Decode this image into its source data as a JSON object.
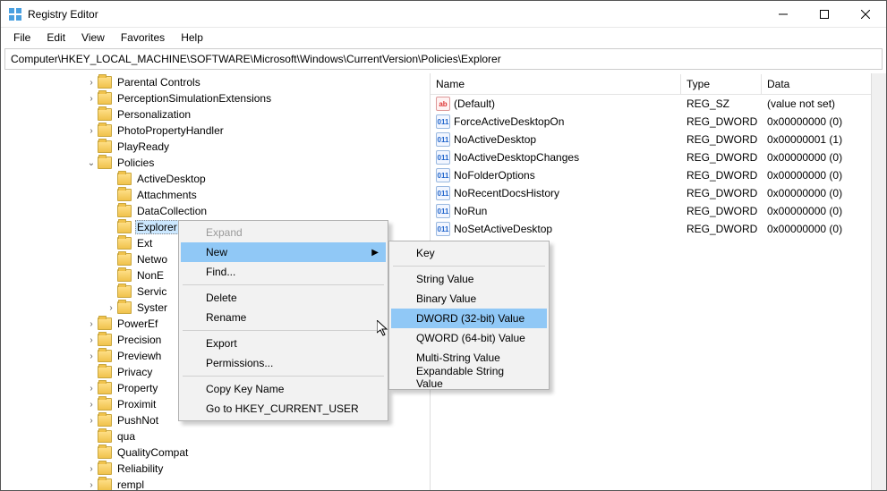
{
  "window": {
    "title": "Registry Editor"
  },
  "menu": [
    "File",
    "Edit",
    "View",
    "Favorites",
    "Help"
  ],
  "address": "Computer\\HKEY_LOCAL_MACHINE\\SOFTWARE\\Microsoft\\Windows\\CurrentVersion\\Policies\\Explorer",
  "tree": [
    {
      "indent": 3,
      "caret": ">",
      "label": "Parental Controls"
    },
    {
      "indent": 3,
      "caret": ">",
      "label": "PerceptionSimulationExtensions"
    },
    {
      "indent": 3,
      "caret": "",
      "label": "Personalization"
    },
    {
      "indent": 3,
      "caret": ">",
      "label": "PhotoPropertyHandler"
    },
    {
      "indent": 3,
      "caret": "",
      "label": "PlayReady"
    },
    {
      "indent": 3,
      "caret": "v",
      "label": "Policies"
    },
    {
      "indent": 4,
      "caret": "",
      "label": "ActiveDesktop"
    },
    {
      "indent": 4,
      "caret": "",
      "label": "Attachments"
    },
    {
      "indent": 4,
      "caret": "",
      "label": "DataCollection"
    },
    {
      "indent": 4,
      "caret": "",
      "label": "Explorer",
      "selected": true
    },
    {
      "indent": 4,
      "caret": "",
      "label": "Ext"
    },
    {
      "indent": 4,
      "caret": "",
      "label": "Netwo"
    },
    {
      "indent": 4,
      "caret": "",
      "label": "NonE"
    },
    {
      "indent": 4,
      "caret": "",
      "label": "Servic"
    },
    {
      "indent": 4,
      "caret": ">",
      "label": "Syster"
    },
    {
      "indent": 3,
      "caret": ">",
      "label": "PowerEf"
    },
    {
      "indent": 3,
      "caret": ">",
      "label": "Precision"
    },
    {
      "indent": 3,
      "caret": ">",
      "label": "Previewh"
    },
    {
      "indent": 3,
      "caret": "",
      "label": "Privacy"
    },
    {
      "indent": 3,
      "caret": ">",
      "label": "Property"
    },
    {
      "indent": 3,
      "caret": ">",
      "label": "Proximit"
    },
    {
      "indent": 3,
      "caret": ">",
      "label": "PushNot"
    },
    {
      "indent": 3,
      "caret": "",
      "label": "qua"
    },
    {
      "indent": 3,
      "caret": "",
      "label": "QualityCompat"
    },
    {
      "indent": 3,
      "caret": ">",
      "label": "Reliability"
    },
    {
      "indent": 3,
      "caret": ">",
      "label": "rempl"
    }
  ],
  "columns": {
    "name": "Name",
    "type": "Type",
    "data": "Data"
  },
  "values": [
    {
      "icon": "sz",
      "name": "(Default)",
      "type": "REG_SZ",
      "data": "(value not set)"
    },
    {
      "icon": "dw",
      "name": "ForceActiveDesktopOn",
      "type": "REG_DWORD",
      "data": "0x00000000 (0)"
    },
    {
      "icon": "dw",
      "name": "NoActiveDesktop",
      "type": "REG_DWORD",
      "data": "0x00000001 (1)"
    },
    {
      "icon": "dw",
      "name": "NoActiveDesktopChanges",
      "type": "REG_DWORD",
      "data": "0x00000000 (0)"
    },
    {
      "icon": "dw",
      "name": "NoFolderOptions",
      "type": "REG_DWORD",
      "data": "0x00000000 (0)"
    },
    {
      "icon": "dw",
      "name": "NoRecentDocsHistory",
      "type": "REG_DWORD",
      "data": "0x00000000 (0)"
    },
    {
      "icon": "dw",
      "name": "NoRun",
      "type": "REG_DWORD",
      "data": "0x00000000 (0)"
    },
    {
      "icon": "dw",
      "name": "NoSetActiveDesktop",
      "type": "REG_DWORD",
      "data": "0x00000000 (0)"
    }
  ],
  "context_menu_1": {
    "items": [
      {
        "label": "Expand",
        "disabled": true
      },
      {
        "label": "New",
        "highlight": true,
        "submenu": true
      },
      {
        "label": "Find..."
      },
      {
        "sep": true
      },
      {
        "label": "Delete"
      },
      {
        "label": "Rename"
      },
      {
        "sep": true
      },
      {
        "label": "Export"
      },
      {
        "label": "Permissions..."
      },
      {
        "sep": true
      },
      {
        "label": "Copy Key Name"
      },
      {
        "label": "Go to HKEY_CURRENT_USER"
      }
    ]
  },
  "context_menu_2": {
    "items": [
      {
        "label": "Key"
      },
      {
        "sep": true
      },
      {
        "label": "String Value"
      },
      {
        "label": "Binary Value"
      },
      {
        "label": "DWORD (32-bit) Value",
        "highlight": true
      },
      {
        "label": "QWORD (64-bit) Value"
      },
      {
        "label": "Multi-String Value"
      },
      {
        "label": "Expandable String Value"
      }
    ]
  }
}
